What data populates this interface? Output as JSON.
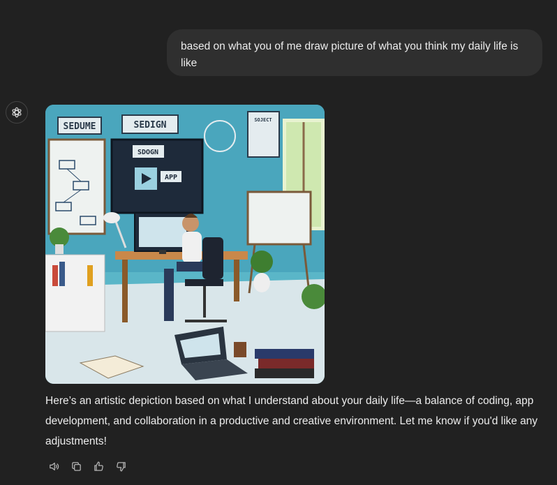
{
  "user_message": {
    "text": "based on what you of me draw picture of what you think my daily life is like"
  },
  "assistant": {
    "avatar_icon": "openai-logo-icon",
    "image": {
      "wall_labels": {
        "sign_left": "SEDUME",
        "sign_right": "SEDIGN",
        "monitor_label": "SDOGN",
        "app_label": "APP",
        "poster_label": "SOJECT"
      }
    },
    "response_text": "Here’s an artistic depiction based on what I understand about your daily life—a balance of coding, app development, and collaboration in a productive and creative environment. Let me know if you'd like any adjustments!",
    "actions": [
      {
        "name": "read-aloud-icon"
      },
      {
        "name": "copy-icon"
      },
      {
        "name": "thumbs-up-icon"
      },
      {
        "name": "thumbs-down-icon"
      }
    ]
  },
  "colors": {
    "background": "#212121",
    "user_bubble": "#2f2f2f",
    "text": "#ececec",
    "icon": "#b4b4b4"
  }
}
